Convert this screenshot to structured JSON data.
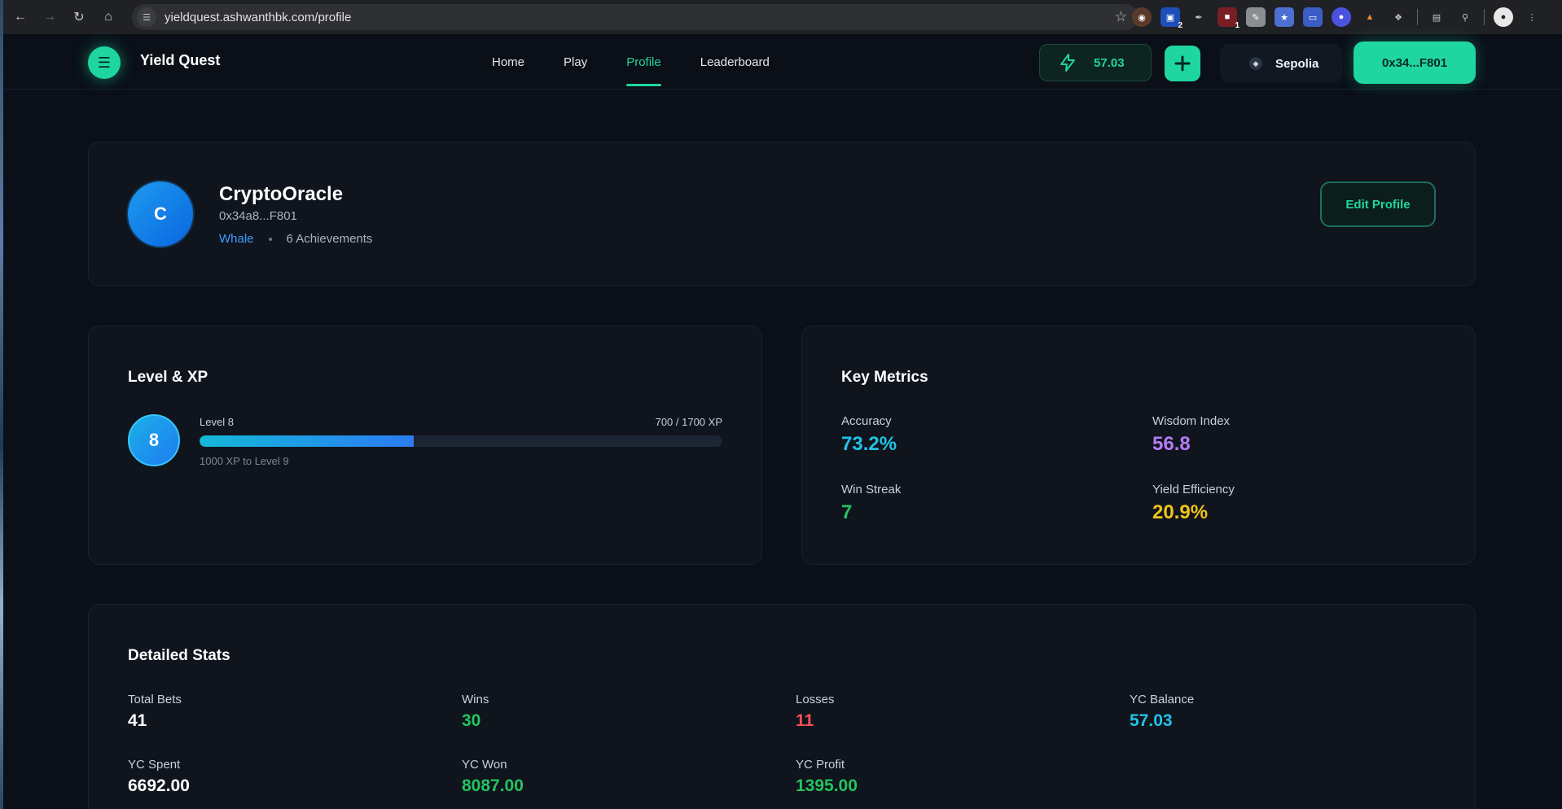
{
  "browser": {
    "url": "yieldquest.ashwanthbk.com/profile",
    "extension_badges": [
      "2",
      "1"
    ]
  },
  "header": {
    "brand": "Yield Quest",
    "logo_glyph": "☰",
    "nav": [
      {
        "label": "Home",
        "active": false
      },
      {
        "label": "Play",
        "active": false
      },
      {
        "label": "Profile",
        "active": true
      },
      {
        "label": "Leaderboard",
        "active": false
      }
    ],
    "balance": "57.03",
    "network": "Sepolia",
    "wallet": "0x34...F801"
  },
  "profile": {
    "avatar_letter": "C",
    "name": "CryptoOracle",
    "address": "0x34a8...F801",
    "rank": "Whale",
    "achievements": "6 Achievements",
    "edit_label": "Edit Profile"
  },
  "level": {
    "title": "Level & XP",
    "level_number": "8",
    "level_label": "Level 8",
    "xp_text": "700 / 1700 XP",
    "xp_fraction": 0.41,
    "next_text": "1000 XP to Level 9"
  },
  "metrics": {
    "title": "Key Metrics",
    "items": [
      {
        "label": "Accuracy",
        "value": "73.2%",
        "color": "#22c3e6"
      },
      {
        "label": "Wisdom Index",
        "value": "56.8",
        "color": "#b37cf5"
      },
      {
        "label": "Win Streak",
        "value": "7",
        "color": "#22c55e"
      },
      {
        "label": "Yield Efficiency",
        "value": "20.9%",
        "color": "#f0c419"
      }
    ]
  },
  "stats": {
    "title": "Detailed Stats",
    "items": [
      {
        "label": "Total Bets",
        "value": "41",
        "color": "#ffffff"
      },
      {
        "label": "Wins",
        "value": "30",
        "color": "#22c55e"
      },
      {
        "label": "Losses",
        "value": "11",
        "color": "#f05252"
      },
      {
        "label": "YC Balance",
        "value": "57.03",
        "color": "#22c3e6"
      },
      {
        "label": "YC Spent",
        "value": "6692.00",
        "color": "#ffffff"
      },
      {
        "label": "YC Won",
        "value": "8087.00",
        "color": "#22c55e"
      },
      {
        "label": "YC Profit",
        "value": "1395.00",
        "color": "#22c55e"
      }
    ]
  },
  "colors": {
    "accent": "#1fd6a0",
    "background": "#0a0f18",
    "card": "#0f141d"
  }
}
